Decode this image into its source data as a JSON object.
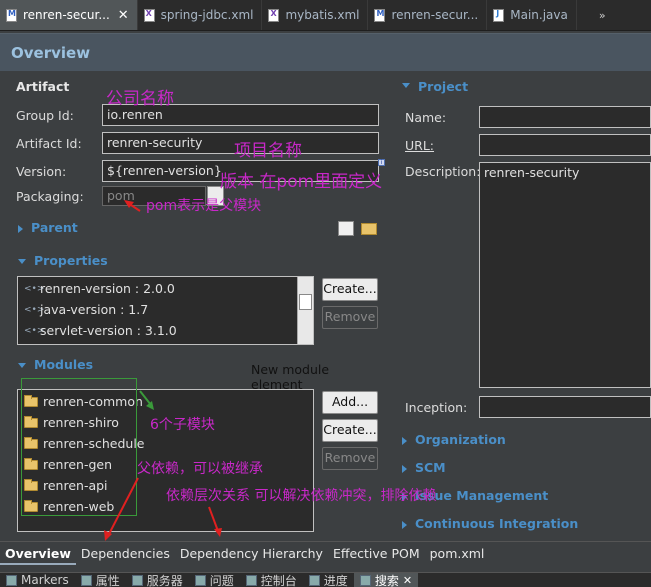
{
  "editor_tabs": [
    {
      "label": "renren-secur...",
      "icon": "maven-pom-icon",
      "active": true
    },
    {
      "label": "spring-jdbc.xml",
      "icon": "xml-file-icon",
      "active": false
    },
    {
      "label": "mybatis.xml",
      "icon": "xml-file-icon",
      "active": false
    },
    {
      "label": "renren-secur...",
      "icon": "maven-pom-icon",
      "active": false
    },
    {
      "label": "Main.java",
      "icon": "java-file-icon",
      "active": false
    }
  ],
  "tabs_overflow": "»",
  "header": {
    "title": "Overview"
  },
  "artifact": {
    "section_title": "Artifact",
    "group_id_label": "Group Id:",
    "group_id_value": "io.renren",
    "artifact_id_label": "Artifact Id:",
    "artifact_id_value": "renren-security",
    "version_label": "Version:",
    "version_value": "${renren-version}",
    "packaging_label": "Packaging:",
    "packaging_value": "pom"
  },
  "parent": {
    "section_title": "Parent"
  },
  "properties": {
    "section_title": "Properties",
    "items": [
      "renren-version : 2.0.0",
      "java-version : 1.7",
      "servlet-version : 3.1.0"
    ],
    "create_label": "Create...",
    "remove_label": "Remove"
  },
  "modules": {
    "section_title": "Modules",
    "new_element_label": "New module element",
    "items": [
      "renren-common",
      "renren-shiro",
      "renren-schedule",
      "renren-gen",
      "renren-api",
      "renren-web"
    ],
    "add_label": "Add...",
    "create_label": "Create...",
    "remove_label": "Remove"
  },
  "project": {
    "section_title": "Project",
    "name_label": "Name:",
    "name_value": "",
    "url_label": "URL:",
    "url_value": "",
    "description_label": "Description:",
    "description_value": "renren-security",
    "inception_label": "Inception:",
    "inception_value": ""
  },
  "right_sections": [
    "Organization",
    "SCM",
    "Issue Management",
    "Continuous Integration"
  ],
  "annotations": {
    "company_name": "公司名称",
    "project_name": "项目名称",
    "version_note": "版本 在pom里面定义",
    "packaging_note": "pom表示是父模块",
    "submodules_note": "6个子模块",
    "parent_dep_note": "父依赖，可以被继承",
    "hierarchy_note": "依赖层次关系 可以解决依赖冲突，排除依赖"
  },
  "page_tabs": [
    "Overview",
    "Dependencies",
    "Dependency Hierarchy",
    "Effective POM",
    "pom.xml"
  ],
  "view_tabs": [
    {
      "label": "Markers",
      "active": false
    },
    {
      "label": "属性",
      "active": false
    },
    {
      "label": "服务器",
      "active": false
    },
    {
      "label": "问题",
      "active": false
    },
    {
      "label": "控制台",
      "active": false
    },
    {
      "label": "进度",
      "active": false
    },
    {
      "label": "搜索",
      "active": true
    }
  ],
  "colors": {
    "annotation": "#c828c8",
    "section_link": "#4a8fc8",
    "arrow": "#e02020"
  }
}
